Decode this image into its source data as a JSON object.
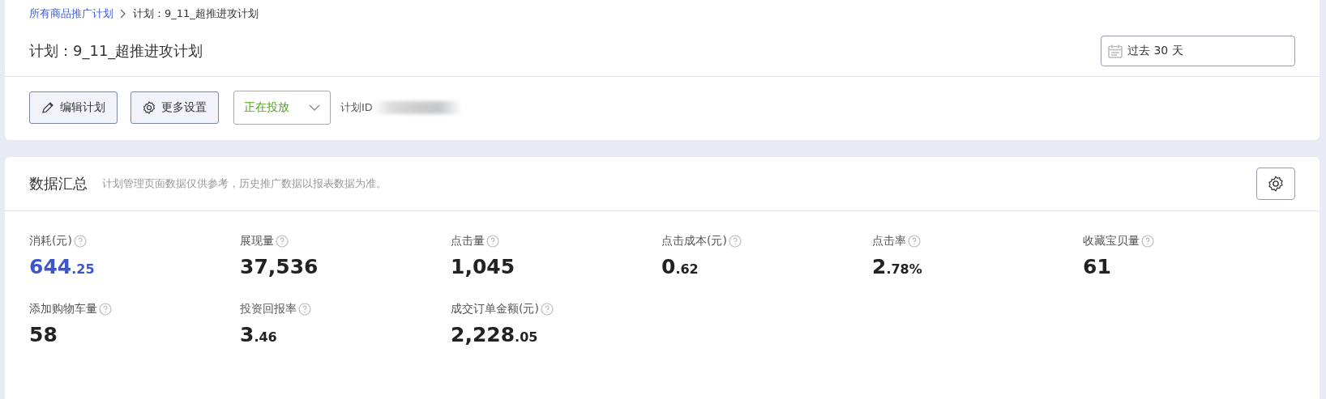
{
  "breadcrumb": [
    {
      "label": "所有商品推广计划",
      "link": true
    },
    {
      "label": "计划：9_11_超推进攻计划",
      "link": false
    }
  ],
  "plan": {
    "title": "计划：9_11_超推进攻计划",
    "date_range": "过去 30 天",
    "actions": [
      "编辑计划",
      "更多设置"
    ],
    "status": "正在投放",
    "id_label": "计划ID"
  },
  "summary": {
    "title": "数据汇总",
    "note": "计划管理页面数据仅供参考，历史推广数据以报表数据为准。",
    "metrics": [
      {
        "label": "消耗(元)",
        "value": "644",
        "fraction": ".25",
        "selected": true
      },
      {
        "label": "展现量",
        "value": "37,536",
        "selected": false
      },
      {
        "label": "点击量",
        "value": "1,045",
        "selected": false
      },
      {
        "label": "点击成本(元)",
        "value": "0",
        "fraction": ".62",
        "selected": false
      },
      {
        "label": "点击率",
        "value": "2",
        "fraction": ".78%",
        "selected": false
      },
      {
        "label": "收藏宝贝量",
        "value": "61",
        "selected": false
      },
      {
        "label": "添加购物车量",
        "value": "58",
        "selected": false
      },
      {
        "label": "投资回报率",
        "value": "3",
        "fraction": ".46",
        "selected": false
      },
      {
        "label": "成交订单金额(元)",
        "value": "2,228",
        "fraction": ".05",
        "selected": false
      }
    ]
  }
}
